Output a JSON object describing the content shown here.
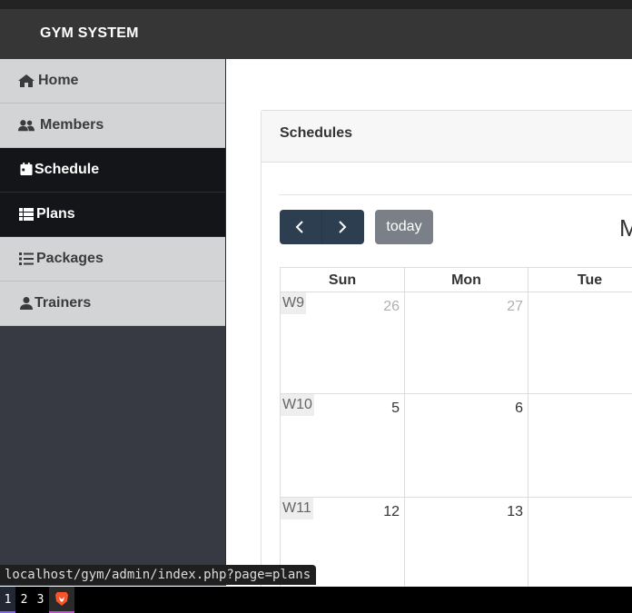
{
  "app": {
    "brand": "GYM SYSTEM"
  },
  "sidebar": {
    "items": [
      {
        "label": "Home",
        "icon": "home-icon",
        "active": false
      },
      {
        "label": "Members",
        "icon": "users-icon",
        "active": false
      },
      {
        "label": "Schedule",
        "icon": "calendar-icon",
        "active": true
      },
      {
        "label": "Plans",
        "icon": "grid-list-icon",
        "active": true
      },
      {
        "label": "Packages",
        "icon": "list-icon",
        "active": false
      },
      {
        "label": "Trainers",
        "icon": "user-icon",
        "active": false
      }
    ]
  },
  "card": {
    "title": "Schedules"
  },
  "calendar": {
    "today_label": "today",
    "title_partial": "M",
    "days_of_week": [
      "Sun",
      "Mon",
      "Tue"
    ],
    "weeks": [
      {
        "label": "W9",
        "days": [
          "26",
          "27"
        ],
        "other_month": true
      },
      {
        "label": "W10",
        "days": [
          "5",
          "6"
        ],
        "other_month": false
      },
      {
        "label": "W11",
        "days": [
          "12",
          "13"
        ],
        "other_month": false
      }
    ]
  },
  "statusbar": {
    "url": "localhost/gym/admin/index.php?page=plans"
  },
  "taskbar": {
    "workspaces": [
      "1",
      "2",
      "3"
    ],
    "app_icon": "brave-browser-icon"
  },
  "colors": {
    "navbar": "#363636",
    "active_item": "#141518",
    "nav_button": "#2c3e50",
    "today_button": "#7b8088",
    "sidebar_bg": "#373a43"
  }
}
